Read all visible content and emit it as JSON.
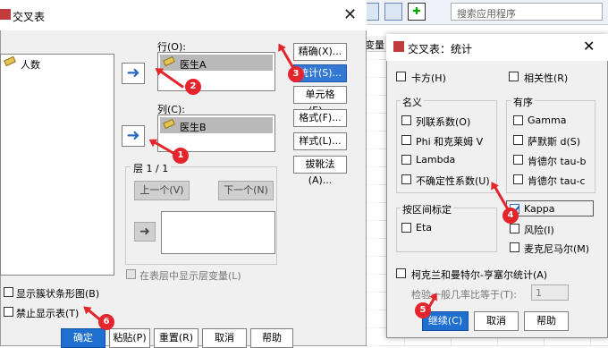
{
  "background": {
    "search_placeholder": "搜索应用程序",
    "column_header": "变量"
  },
  "main_dialog": {
    "title": "交叉表",
    "variables": [
      "人数"
    ],
    "row_label": "行(O):",
    "row_items": [
      "医生A"
    ],
    "col_label": "列(C):",
    "col_items": [
      "医生B"
    ],
    "layer_label": "层 1 / 1",
    "prev_label": "上一个(V)",
    "next_label": "下一个(N)",
    "layer_check": "在表层中显示层变量(L)",
    "right_buttons": [
      "精确(X)...",
      "统计(S)...",
      "单元格(E)...",
      "格式(F)...",
      "样式(L)...",
      "拔靴法(A)..."
    ],
    "active_right_button": 1,
    "opt_bar_chart": "显示簇状条形图(B)",
    "opt_suppress": "禁止显示表(T)",
    "bottom_buttons": [
      "确定",
      "粘贴(P)",
      "重置(R)",
      "取消",
      "帮助"
    ]
  },
  "stats_dialog": {
    "title": "交叉表：统计",
    "chisq": "卡方(H)",
    "corr": "相关性(R)",
    "nominal_title": "名义",
    "nominal": [
      "列联系数(O)",
      "Phi 和克莱姆 V",
      "Lambda",
      "不确定性系数(U)"
    ],
    "ordinal_title": "有序",
    "ordinal": [
      "Gamma",
      "萨默斯 d(S)",
      "肯德尔 tau-b",
      "肯德尔 tau-c"
    ],
    "interval_title": "按区间标定",
    "interval": [
      "Eta"
    ],
    "kappa": "Kappa",
    "kappa_checked": true,
    "risk": "风险(I)",
    "mcnemar": "麦克尼马尔(M)",
    "cmh": "柯克兰和曼特尔-亨塞尔统计(A)",
    "odds_label": "检验一般几率比等于(T):",
    "odds_value": "1",
    "buttons": [
      "继续(C)",
      "取消",
      "帮助"
    ]
  },
  "annotations": [
    "1",
    "2",
    "3",
    "4",
    "5",
    "6"
  ],
  "colors": {
    "accent": "#1f6fd1",
    "annotation": "#e4252b"
  }
}
